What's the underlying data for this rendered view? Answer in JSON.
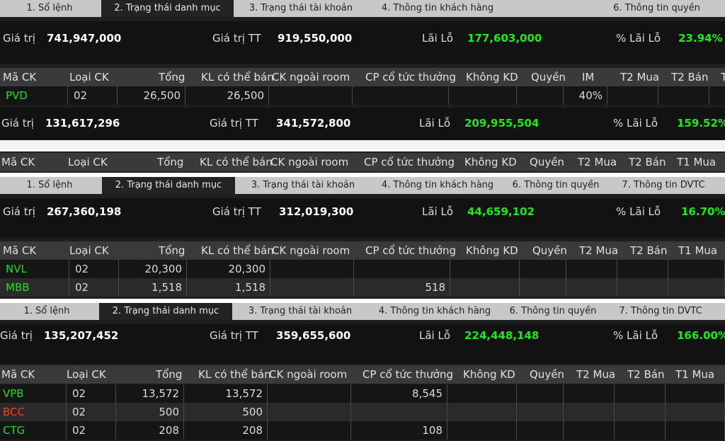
{
  "colors": {
    "accent_green": "#22e622",
    "accent_red": "#ee4422",
    "bg": "#1e1e1e"
  },
  "tabs_a": [
    "1. Sổ lệnh",
    "2. Trạng thái danh mục",
    "3. Trạng thái tài khoản",
    "4. Thông tin khách hàng",
    "6. Thông tin quyền"
  ],
  "tabs_b": [
    "1. Sổ lệnh",
    "2. Trạng thái danh mục",
    "3. Trạng thái tài khoản",
    "4. Thông tin khách hàng",
    "6. Thông tin quyền",
    "7. Thông tin DVTC"
  ],
  "labels": {
    "gia_tri": "Giá trị",
    "gia_tri_tt": "Giá trị TT",
    "lai_lo": "Lãi Lỗ",
    "pct_lai_lo": "% Lãi Lỗ"
  },
  "cols_a": [
    "Mã CK",
    "Loại CK",
    "Tổng",
    "KL có thể bán",
    "CK ngoài room",
    "CP cổ tức thưởng",
    "Không KD",
    "Quyền",
    "IM",
    "T2 Mua",
    "T2 Bán",
    "T"
  ],
  "cols_b": [
    "Mã CK",
    "Loại CK",
    "Tổng",
    "KL có thể bán",
    "CK ngoài room",
    "CP cổ tức thưởng",
    "Không KD",
    "Quyền",
    "T2 Mua",
    "T2 Bán",
    "T1 Mua"
  ],
  "p1": {
    "summary": {
      "gia_tri": "741,947,000",
      "gia_tri_tt": "919,550,000",
      "lai_lo": "177,603,000",
      "pct": "23.94%"
    },
    "rows": [
      {
        "sym": "PVD",
        "loai": "02",
        "tong": "26,500",
        "kl": "26,500",
        "im": "40%"
      }
    ]
  },
  "p2": {
    "summary": {
      "gia_tri": "131,617,296",
      "gia_tri_tt": "341,572,800",
      "lai_lo": "209,955,504",
      "pct": "159.52%"
    }
  },
  "p3": {
    "summary": {
      "gia_tri": "267,360,198",
      "gia_tri_tt": "312,019,300",
      "lai_lo": "44,659,102",
      "pct": "16.70%"
    },
    "rows": [
      {
        "sym": "NVL",
        "loai": "02",
        "tong": "20,300",
        "kl": "20,300",
        "cp": ""
      },
      {
        "sym": "MBB",
        "loai": "02",
        "tong": "1,518",
        "kl": "1,518",
        "cp": "518"
      }
    ]
  },
  "p4": {
    "summary": {
      "gia_tri": "135,207,452",
      "gia_tri_tt": "359,655,600",
      "lai_lo": "224,448,148",
      "pct": "166.00%"
    },
    "rows": [
      {
        "sym": "VPB",
        "loai": "02",
        "tong": "13,572",
        "kl": "13,572",
        "cp": "8,545"
      },
      {
        "sym": "BCC",
        "loai": "02",
        "tong": "500",
        "kl": "500",
        "cp": ""
      },
      {
        "sym": "CTG",
        "loai": "02",
        "tong": "208",
        "kl": "208",
        "cp": "108"
      }
    ]
  }
}
